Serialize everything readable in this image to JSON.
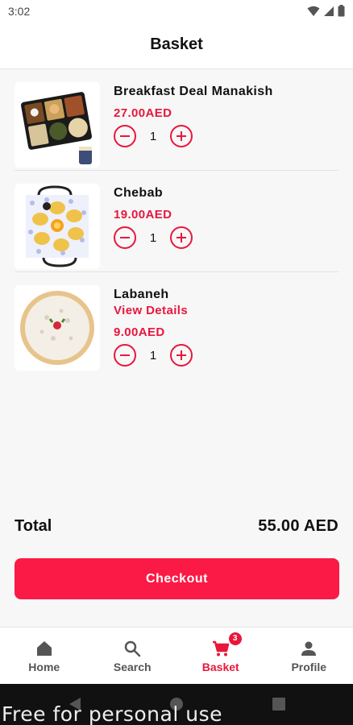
{
  "status_bar": {
    "time": "3:02"
  },
  "header": {
    "title": "Basket"
  },
  "items": [
    {
      "name": "Breakfast Deal Manakish",
      "link": "",
      "price": "27.00AED",
      "qty": "1",
      "image_icon": "breakfast-tray-image"
    },
    {
      "name": "Chebab",
      "link": "",
      "price": "19.00AED",
      "qty": "1",
      "image_icon": "chebab-pan-image"
    },
    {
      "name": "Labaneh",
      "link": "View Details",
      "price": "9.00AED",
      "qty": "1",
      "image_icon": "labaneh-bowl-image"
    }
  ],
  "summary": {
    "total_label": "Total",
    "total_value": "55.00 AED"
  },
  "checkout": {
    "label": "Checkout"
  },
  "nav": {
    "items": [
      {
        "label": "Home",
        "icon": "home-icon"
      },
      {
        "label": "Search",
        "icon": "search-icon"
      },
      {
        "label": "Basket",
        "icon": "cart-icon",
        "badge": "3"
      },
      {
        "label": "Profile",
        "icon": "person-icon"
      }
    ]
  },
  "watermark": "Free for personal use",
  "colors": {
    "accent": "#e8173c",
    "button": "#fb1a45",
    "background": "#f7f7f7"
  }
}
